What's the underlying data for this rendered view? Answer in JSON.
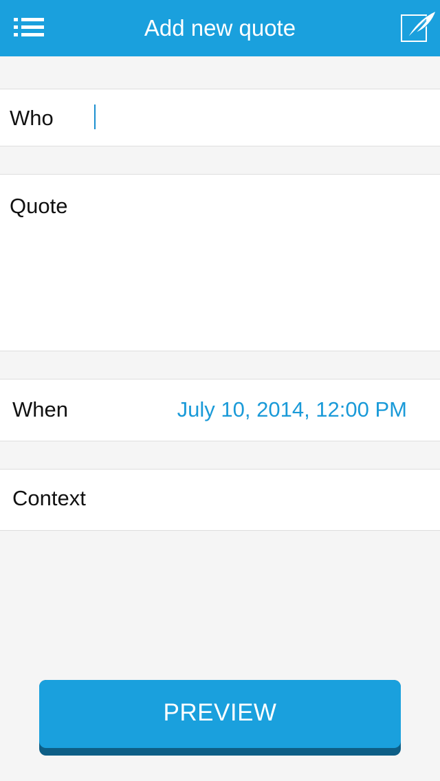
{
  "header": {
    "title": "Add new quote",
    "menu_icon": "list-menu-icon",
    "compose_icon": "quill-feather-icon",
    "background_color": "#1aa0dd"
  },
  "form": {
    "who": {
      "label": "Who",
      "value": ""
    },
    "quote": {
      "label": "Quote",
      "value": ""
    },
    "when": {
      "label": "When",
      "value": "July 10, 2014, 12:00 PM",
      "value_color": "#1a9ad8"
    },
    "context": {
      "label": "Context",
      "value": ""
    }
  },
  "actions": {
    "preview_label": "PREVIEW"
  }
}
